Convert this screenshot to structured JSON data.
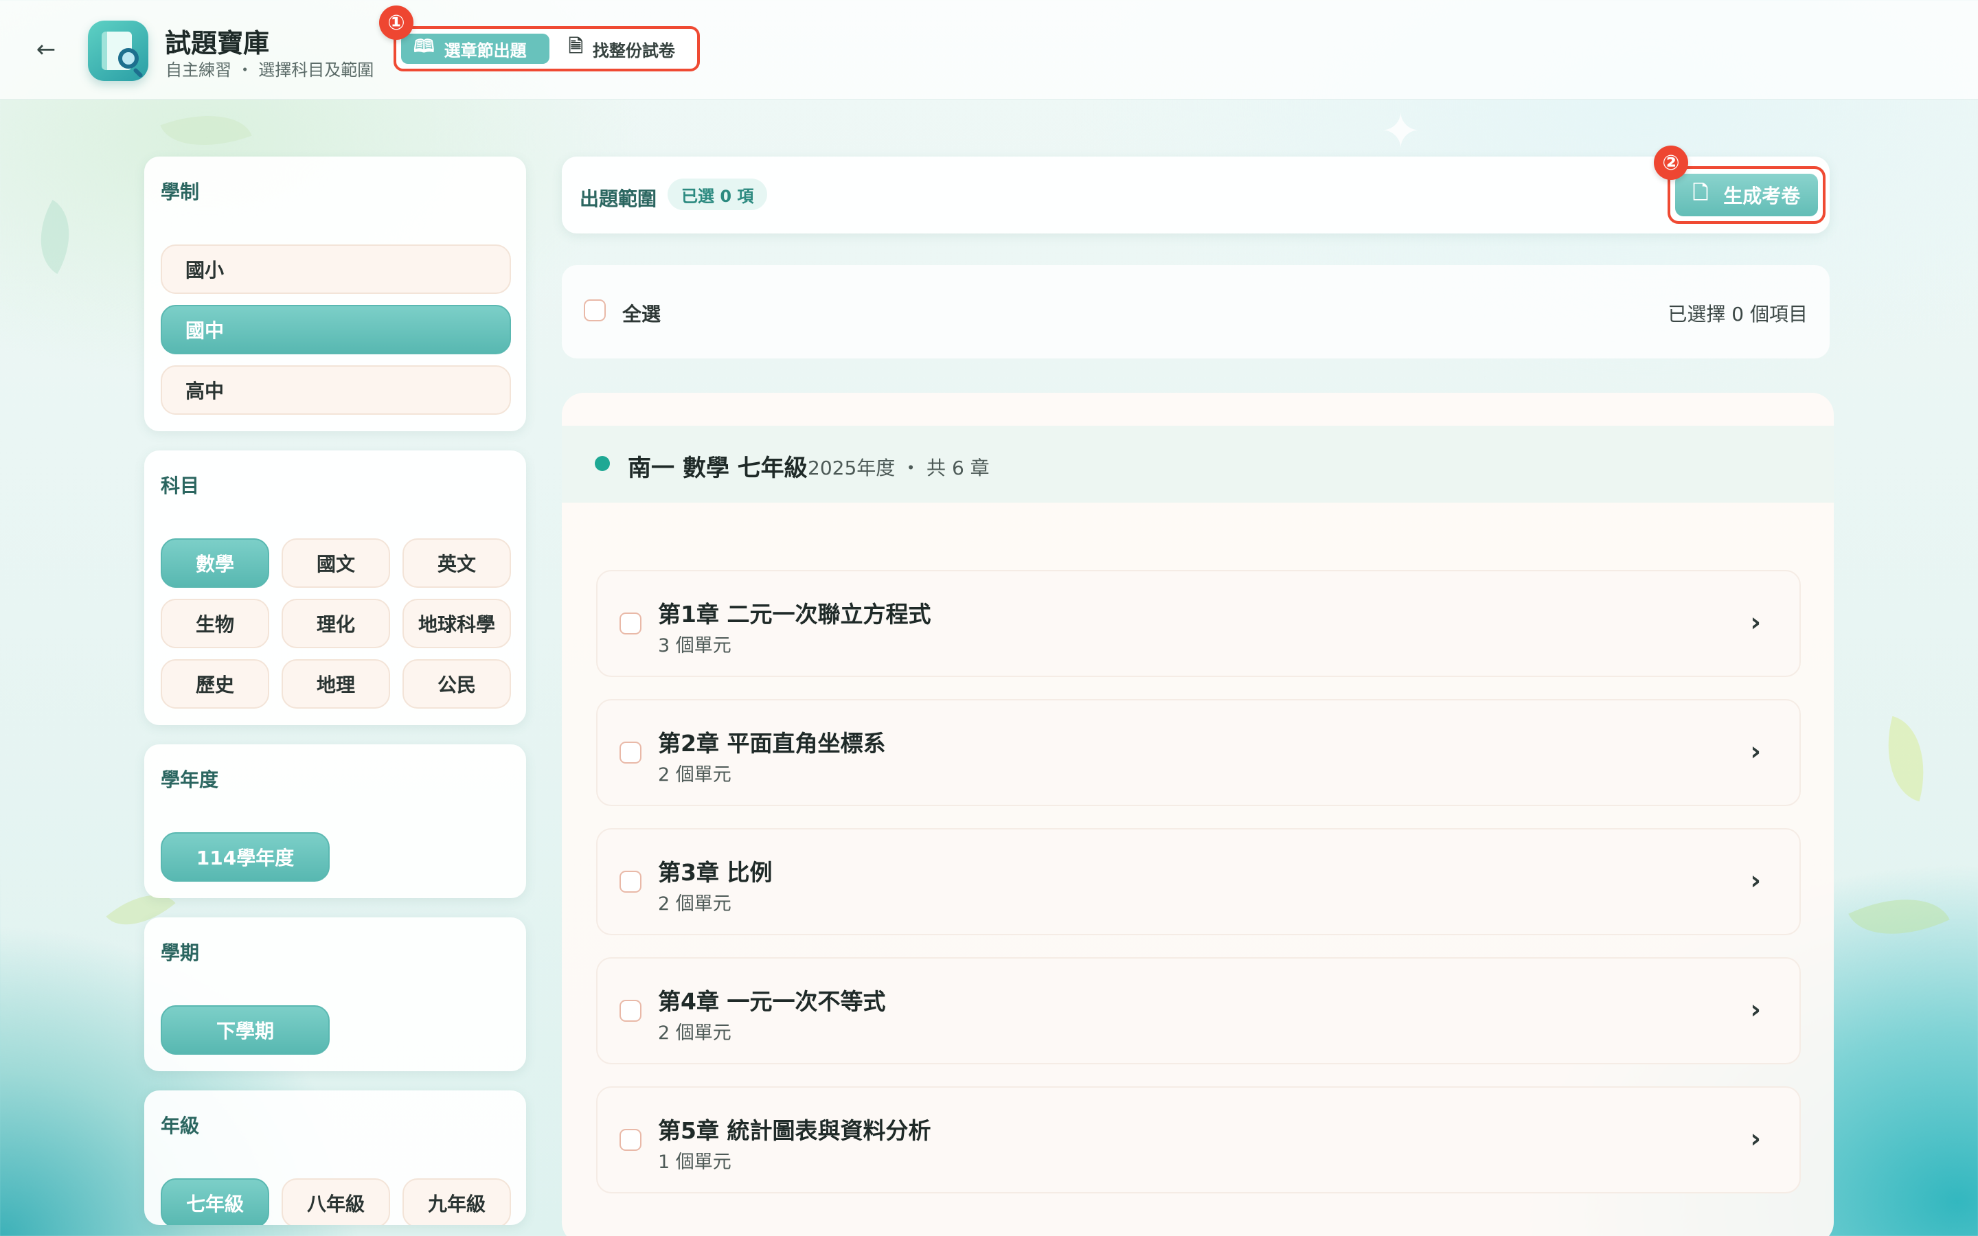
{
  "header": {
    "back_icon": "arrow-left-icon",
    "title": "試題寶庫",
    "subtitle": "自主練習 ・ 選擇科目及範圍",
    "modes": [
      {
        "label": "選章節出題",
        "icon": "open-book-icon",
        "active": true
      },
      {
        "label": "找整份試卷",
        "icon": "document-icon",
        "active": false
      }
    ],
    "callout_1": "①",
    "callout_2": "②"
  },
  "sidebar": {
    "school_level": {
      "title": "學制",
      "options": [
        "國小",
        "國中",
        "高中"
      ],
      "selected": "國中"
    },
    "subject": {
      "title": "科目",
      "options": [
        "數學",
        "國文",
        "英文",
        "生物",
        "理化",
        "地球科學",
        "歷史",
        "地理",
        "公民"
      ],
      "selected": "數學"
    },
    "school_year": {
      "title": "學年度",
      "options": [
        "114學年度"
      ],
      "selected": "114學年度"
    },
    "semester": {
      "title": "學期",
      "options": [
        "下學期"
      ],
      "selected": "下學期"
    },
    "grade": {
      "title": "年級",
      "options": [
        "七年級",
        "八年級",
        "九年級"
      ],
      "selected": "七年級"
    }
  },
  "main": {
    "scope_label": "出題範圍",
    "scope_count": "已選 0 項",
    "generate_label": "生成考卷",
    "select_all_label": "全選",
    "selected_info": "已選擇 0 個項目",
    "textbook": {
      "name": "南一 數學 七年級",
      "meta": "2025年度 ・ 共 6 章"
    },
    "chapters": [
      {
        "title": "第1章 二元一次聯立方程式",
        "units": "3 個單元"
      },
      {
        "title": "第2章 平面直角坐標系",
        "units": "2 個單元"
      },
      {
        "title": "第3章 比例",
        "units": "2 個單元"
      },
      {
        "title": "第4章 一元一次不等式",
        "units": "2 個單元"
      },
      {
        "title": "第5章 統計圖表與資料分析",
        "units": "1 個單元"
      }
    ]
  },
  "colors": {
    "accent": "#5ab8b1",
    "callout": "#ef4a33",
    "section_title": "#2b6660"
  }
}
